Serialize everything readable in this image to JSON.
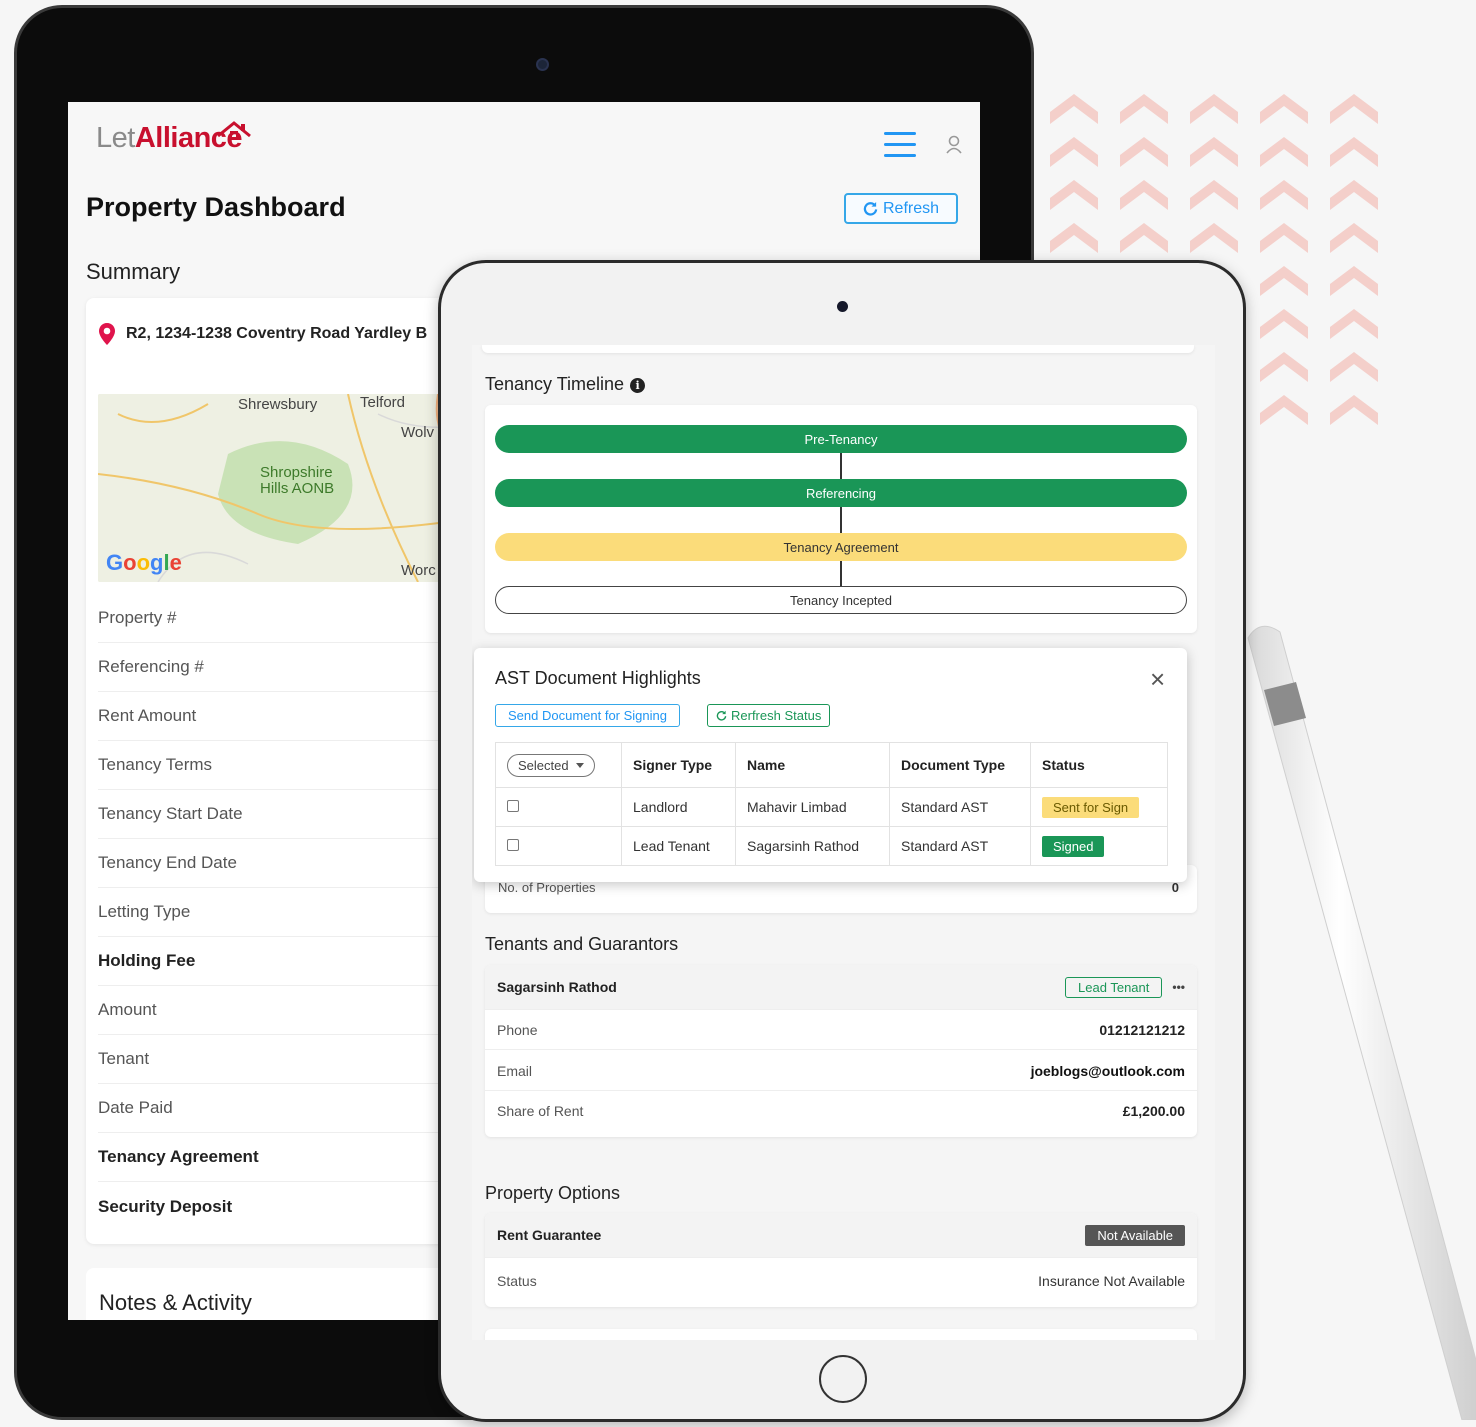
{
  "back_app": {
    "logo_let": "Let",
    "logo_alliance": "Alliance",
    "title": "Property Dashboard",
    "refresh_label": "Refresh",
    "summary_label": "Summary",
    "address": "R2, 1234-1238 Coventry Road Yardley B",
    "map_labels": {
      "shrewsbury": "Shrewsbury",
      "telford": "Telford",
      "wolv": "Wolv",
      "shropshire": "Shropshire",
      "hills": "Hills AONB",
      "worc": "Worc",
      "google": "Google"
    },
    "rows": [
      "Property #",
      "Referencing #",
      "Rent Amount",
      "Tenancy Terms",
      "Tenancy Start Date",
      "Tenancy End Date",
      "Letting Type",
      "Holding Fee",
      "Amount",
      "Tenant",
      "Date Paid",
      "Tenancy Agreement",
      "Security Deposit"
    ],
    "notes_title": "Notes & Activity"
  },
  "front_app": {
    "timeline_title": "Tenancy Timeline",
    "timeline_info_icon": "i",
    "timeline": [
      "Pre-Tenancy",
      "Referencing",
      "Tenancy Agreement",
      "Tenancy Incepted"
    ],
    "colors": {
      "green": "#1a9657",
      "yellow": "#fbdc7a",
      "blue": "#2196f3"
    },
    "ast": {
      "title": "AST Document Highlights",
      "close": "×",
      "send_btn": "Send Document for Signing",
      "refresh_btn": "Rerfresh Status",
      "selected_label": "Selected",
      "headers": [
        "Signer Type",
        "Name",
        "Document Type",
        "Status"
      ],
      "rows": [
        {
          "signer": "Landlord",
          "name": "Mahavir Limbad",
          "doc": "Standard AST",
          "status": "Sent for Sign"
        },
        {
          "signer": "Lead Tenant",
          "name": "Sagarsinh Rathod",
          "doc": "Standard AST",
          "status": "Signed"
        }
      ]
    },
    "properties_label": "No. of Properties",
    "properties_value": "0",
    "tenants_title": "Tenants and Guarantors",
    "tenant": {
      "name": "Sagarsinh Rathod",
      "badge": "Lead Tenant",
      "more": "•••",
      "phone_label": "Phone",
      "phone": "01212121212",
      "email_label": "Email",
      "email": "joeblogs@outlook.com",
      "share_label": "Share of Rent",
      "share": "£1,200.00"
    },
    "options_title": "Property Options",
    "options": {
      "rent_guarantee": "Rent Guarantee",
      "not_available": "Not Available",
      "status_label": "Status",
      "status_value": "Insurance Not Available"
    }
  }
}
